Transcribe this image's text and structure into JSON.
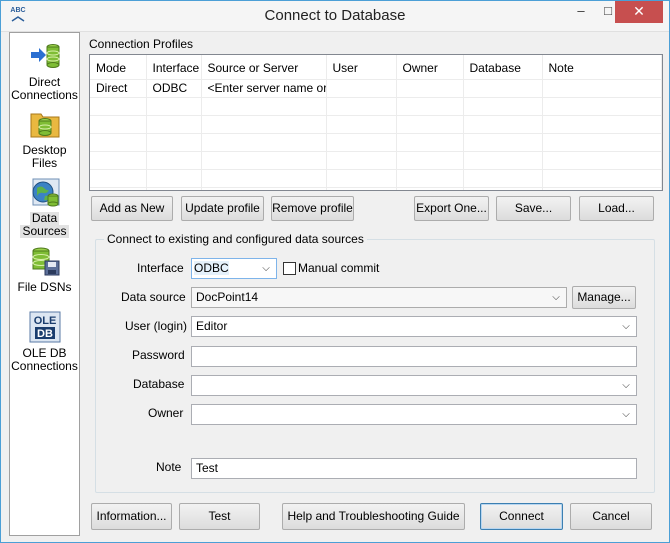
{
  "window": {
    "title": "Connect to Database",
    "app_icon_text": "ABC",
    "controls": {
      "minimize": "–",
      "maximize": "□",
      "close": "✕"
    }
  },
  "sidebar": {
    "items": [
      {
        "label_line1": "Direct",
        "label_line2": "Connections",
        "icon": "arrow-database-icon"
      },
      {
        "label_line1": "Desktop",
        "label_line2": "Files",
        "icon": "folder-database-icon"
      },
      {
        "label_line1": "Data",
        "label_line2": "Sources",
        "icon": "globe-database-icon",
        "selected": true
      },
      {
        "label_line1": "File DSNs",
        "label_line2": "",
        "icon": "disk-database-icon"
      },
      {
        "label_line1": "OLE DB",
        "label_line2": "Connections",
        "icon": "ole-db-icon",
        "icon_text_1": "OLE",
        "icon_text_2": "DB"
      }
    ]
  },
  "profiles": {
    "section_label": "Connection Profiles",
    "columns": [
      "Mode",
      "Interface",
      "Source or Server",
      "User",
      "Owner",
      "Database",
      "Note"
    ],
    "rows": [
      [
        "Direct",
        "ODBC",
        "<Enter server name or...",
        "",
        "",
        "",
        ""
      ]
    ]
  },
  "profile_buttons": {
    "add_as_new": "Add as New",
    "update_profile": "Update profile",
    "remove_profile": "Remove profile",
    "export_one": "Export One...",
    "save": "Save...",
    "load": "Load..."
  },
  "connect_group": {
    "title": "Connect to existing and configured data sources",
    "interface_label": "Interface",
    "interface_value": "ODBC",
    "manual_commit_label": "Manual commit",
    "data_source_label": "Data source",
    "data_source_value": "DocPoint14",
    "manage_button": "Manage...",
    "user_label": "User (login)",
    "user_value": "Editor",
    "password_label": "Password",
    "password_value": "",
    "database_label": "Database",
    "database_value": "",
    "owner_label": "Owner",
    "owner_value": "",
    "note_label": "Note",
    "note_value": "Test"
  },
  "footer_buttons": {
    "information": "Information...",
    "test": "Test",
    "help": "Help and Troubleshooting Guide",
    "connect": "Connect",
    "cancel": "Cancel"
  }
}
